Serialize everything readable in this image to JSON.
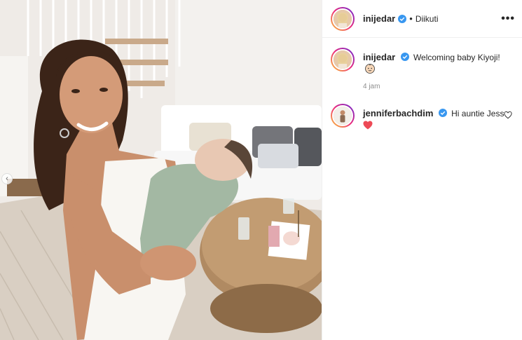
{
  "post": {
    "username": "inijedar",
    "follow_status": "Diikuti",
    "more_label": "•••"
  },
  "comments": [
    {
      "username": "inijedar",
      "text": "Welcoming baby Kiyoji!",
      "emoji": "baby-face",
      "timestamp": "4 jam"
    },
    {
      "username": "jenniferbachdim",
      "text": "Hi auntie Jess",
      "emoji": "red-heart"
    }
  ],
  "colors": {
    "verified": "#3897f0",
    "heart": "#ed4956",
    "meta": "#8e8e8e"
  },
  "icons": [
    "verified-badge-icon",
    "more-options-icon",
    "heart-outline-icon",
    "chevron-left-icon"
  ]
}
